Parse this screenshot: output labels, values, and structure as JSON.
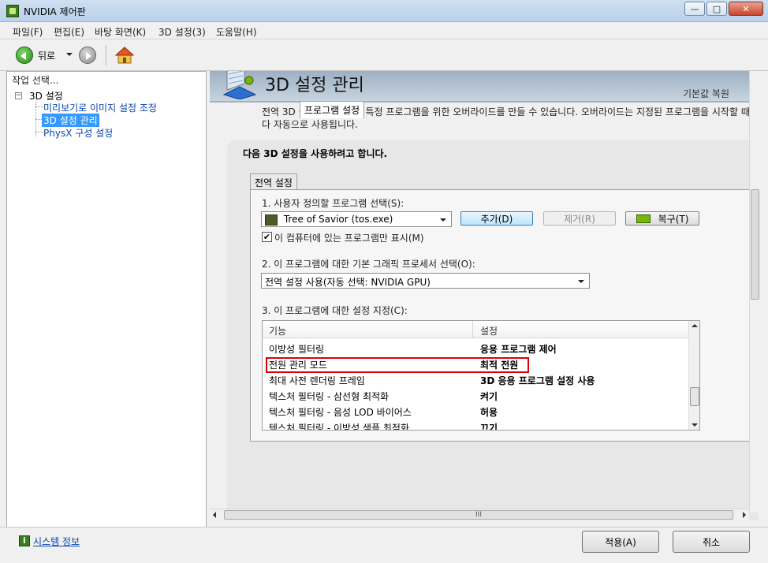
{
  "window": {
    "title": "NVIDIA 제어판",
    "minimize": "—",
    "maximize": "□",
    "close": "✕"
  },
  "menu": [
    "파일(F)",
    "편집(E)",
    "바탕 화면(K)",
    "3D 설정(3)",
    "도움말(H)"
  ],
  "toolbar": {
    "back_label": "뒤로"
  },
  "left": {
    "header": "작업 선택...",
    "tree": {
      "root": "3D 설정",
      "children": [
        "미리보기로 이미지 설정 조정",
        "3D 설정 관리",
        "PhysX 구성 설정"
      ],
      "selected_index": 1
    }
  },
  "right": {
    "title": "3D 설정 관리",
    "restore_defaults": "기본값 복원",
    "description": "전역 3D 설정을 변경하고 특정 프로그램을 위한 오버라이드를 만들 수 있습니다. 오버라이드는 지정된 프로그램을 시작할 때마다 자동으로 사용됩니다.",
    "group_title": "다음 3D 설정을 사용하려고 합니다.",
    "tabs": [
      "전역 설정",
      "프로그램 설정"
    ],
    "active_tab": 1,
    "step1_label": "1. 사용자 정의할 프로그램 선택(S):",
    "program_selected": "Tree of Savior (tos.exe)",
    "add_button": "추가(D)",
    "remove_button": "제거(R)",
    "restore_button": "복구(T)",
    "checkbox_label": "이 컴퓨터에 있는 프로그램만 표시(M)",
    "checkbox_checked": true,
    "step2_label": "2. 이 프로그램에 대한 기본 그래픽 프로세서 선택(O):",
    "gpu_selected": "전역 설정 사용(자동 선택: NVIDIA GPU)",
    "step3_label": "3. 이 프로그램에 대한 설정 지정(C):",
    "columns": [
      "기능",
      "설정"
    ],
    "rows": [
      {
        "feature": "이방성 필터링",
        "value": "응용 프로그램 제어"
      },
      {
        "feature": "전원 관리 모드",
        "value": "최적 전원"
      },
      {
        "feature": "최대 사전 렌더링 프레임",
        "value": "3D 응용 프로그램 설정 사용"
      },
      {
        "feature": "텍스처 필터링 - 삼선형 최적화",
        "value": "켜기"
      },
      {
        "feature": "텍스처 필터링 - 음성 LOD 바이어스",
        "value": "허용"
      },
      {
        "feature": "텍스처 필터링 - 이방성 샘플 최적화",
        "value": "끄기"
      }
    ],
    "highlighted_row": 1,
    "hscroll_label": "III"
  },
  "bottom": {
    "system_info": "시스템 정보",
    "apply": "적용(A)",
    "cancel": "취소"
  },
  "colors": {
    "highlight": "#e00000",
    "selection": "#3399ff",
    "link": "#0645ad"
  }
}
